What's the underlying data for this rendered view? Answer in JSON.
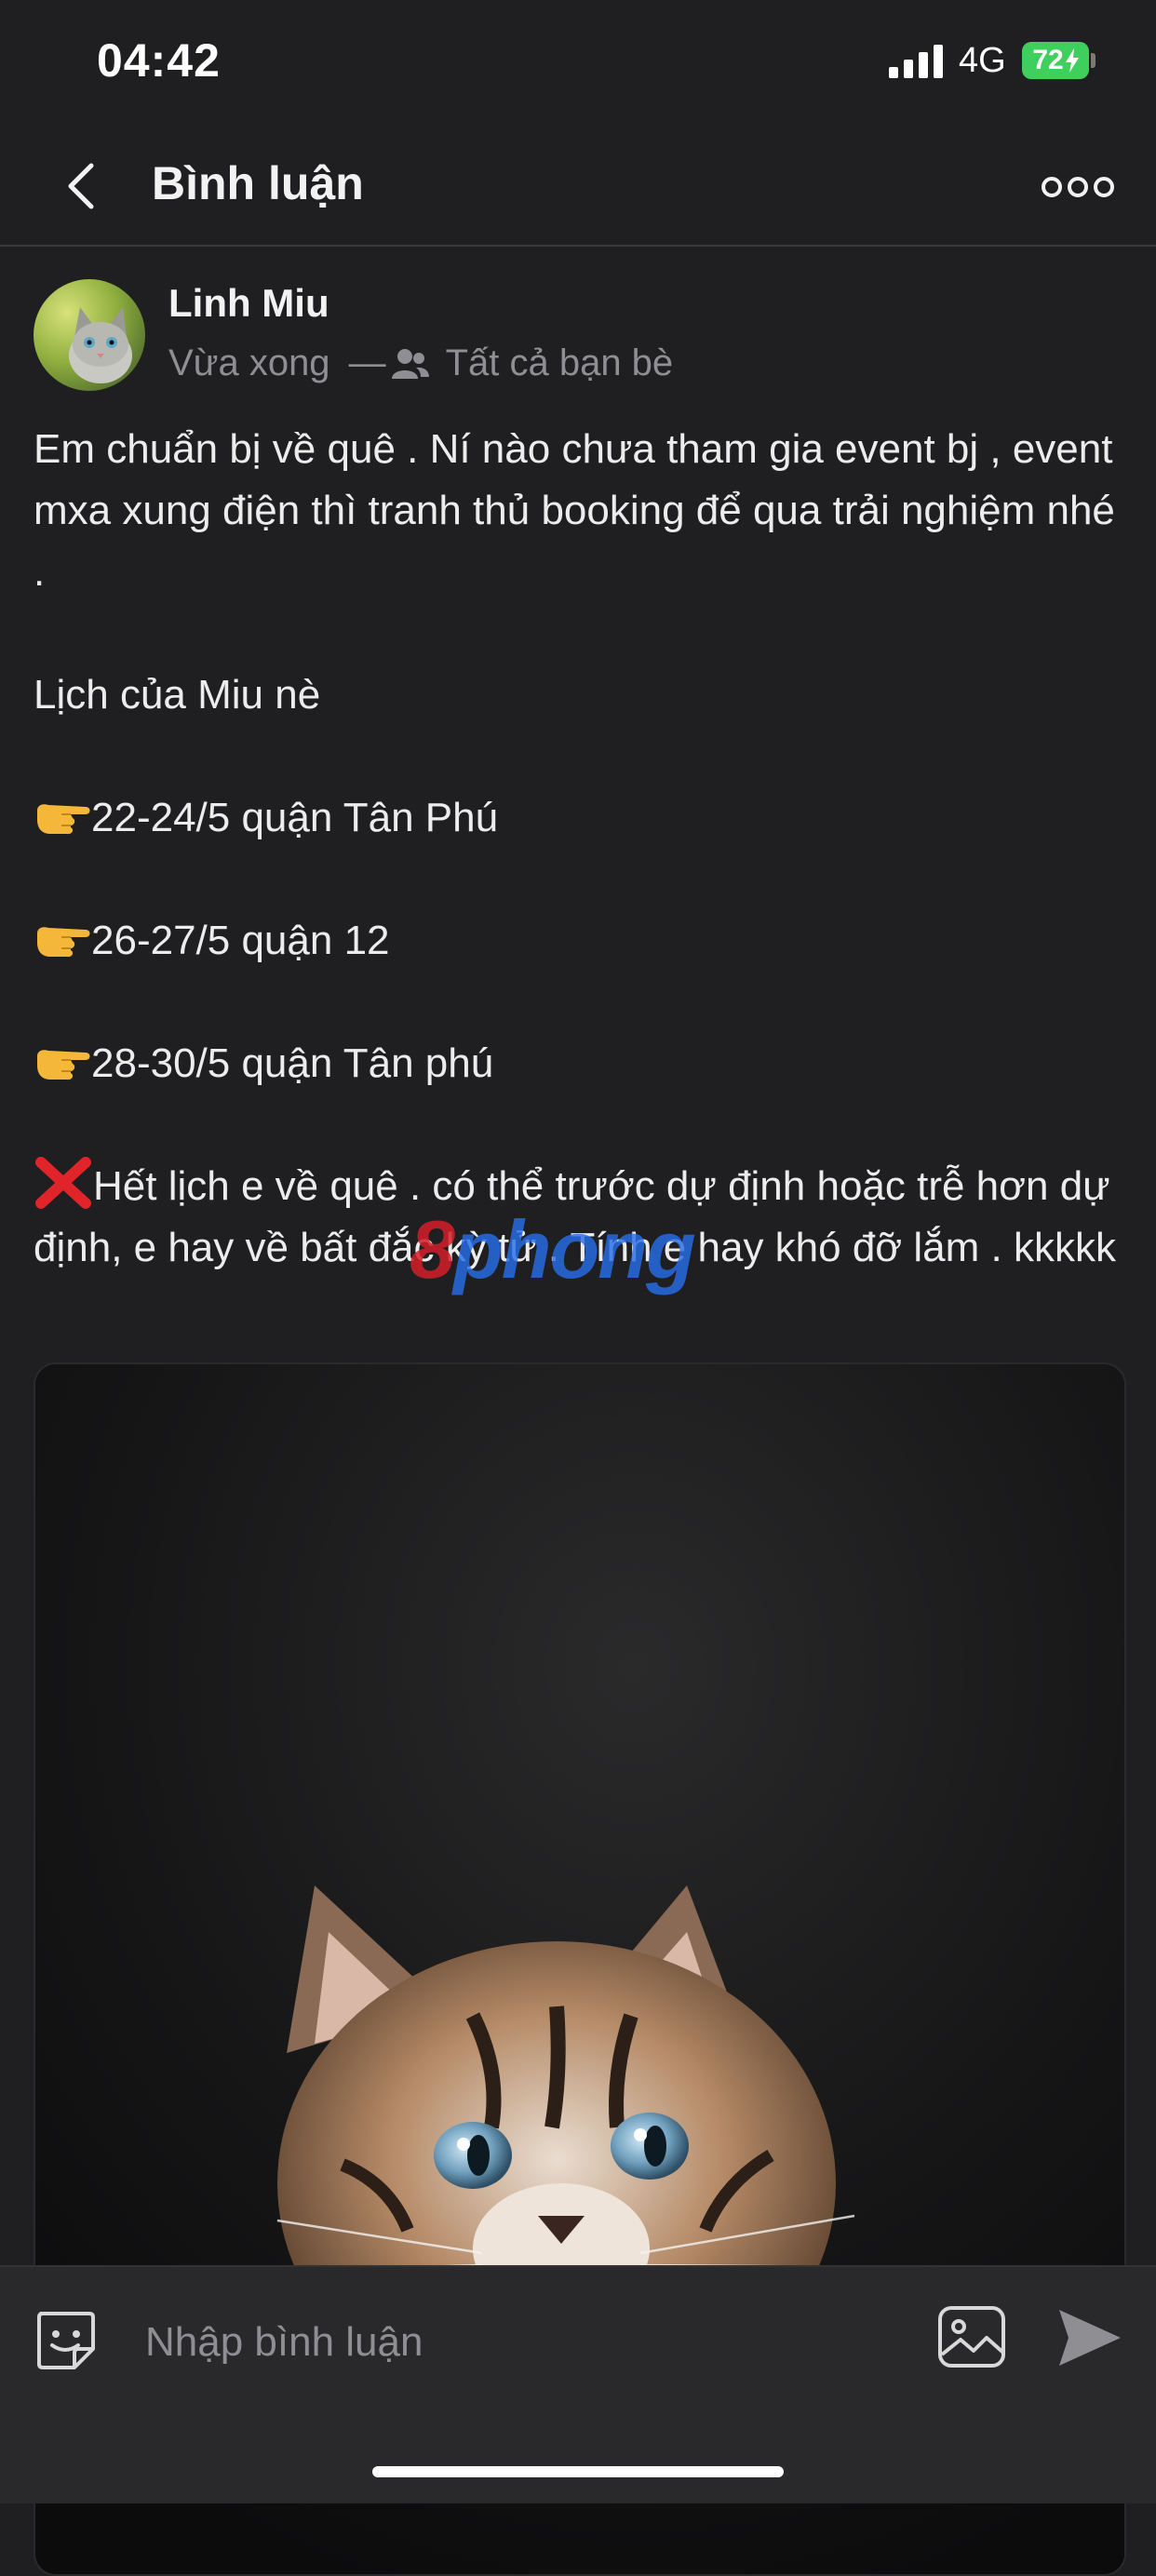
{
  "status_bar": {
    "time": "04:42",
    "network": "4G",
    "battery": "72"
  },
  "header": {
    "title": "Bình luận"
  },
  "post": {
    "author": "Linh Miu",
    "timestamp": "Vừa xong",
    "separator": "—",
    "audience": "Tất cả bạn bè",
    "lines": {
      "intro": "Em chuẩn bị về quê . Ní nào chưa tham gia event bj , event mxa xung điện thì tranh thủ booking để qua trải nghiệm nhé .",
      "schedule_heading": "Lịch của Miu nè",
      "item1": "22-24/5 quận Tân Phú",
      "item2": "26-27/5 quận 12",
      "item3": "28-30/5 quận Tân phú",
      "closing": "Hết lịch e về quê . có thể trước dự định hoặc trễ hơn dự định, e hay về bất đắc kỳ tử . Tính e hay khó đỡ lắm . kkkkk"
    }
  },
  "watermark": {
    "first": "8",
    "rest": "phong"
  },
  "comment_bar": {
    "placeholder": "Nhập bình luận"
  },
  "icons": {
    "back": "chevron-left-icon",
    "more": "more-dots-icon",
    "audience": "friends-icon",
    "pointer": "pointing-hand-emoji",
    "cross": "cross-mark-emoji",
    "sticker": "sticker-icon",
    "image": "image-icon",
    "send": "send-icon"
  },
  "colors": {
    "background": "#1f1f21",
    "battery": "#3ecf5d",
    "muted_text": "#8e8e93"
  }
}
